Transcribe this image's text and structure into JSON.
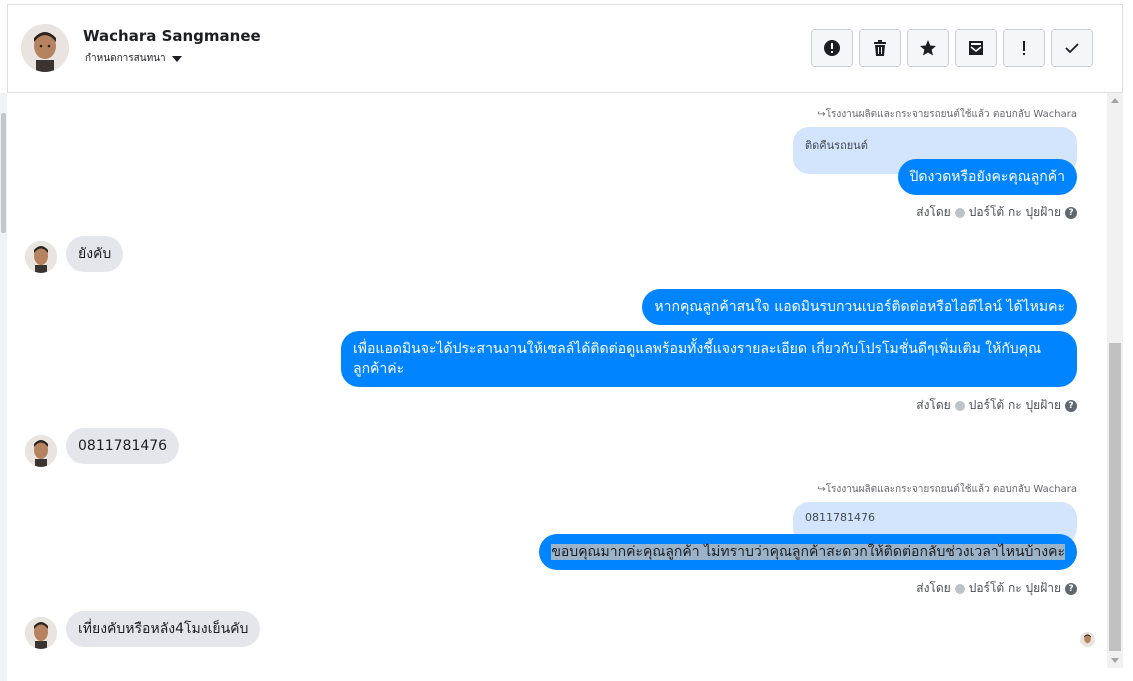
{
  "header": {
    "name": "Wachara Sangmanee",
    "subtitle": "กำหนดการสนทนา",
    "toolbar": [
      {
        "name": "report-icon"
      },
      {
        "name": "trash-icon"
      },
      {
        "name": "star-icon"
      },
      {
        "name": "mark-unread-icon"
      },
      {
        "name": "exclamation-icon"
      },
      {
        "name": "check-icon"
      }
    ]
  },
  "conversation": {
    "reply_note": "โรงงานผลิตและกระจายรถยนต์ใช้แล้ว ตอบกลับ Wachara",
    "sent_by": "ส่งโดย",
    "sender_name": "ปอร์โต้ กะ ปุยฝ้าย",
    "messages": {
      "q1": "ติดคืนรถยนต์",
      "o1": "ปิดงวดหรือยังคะคุณลูกค้า",
      "i1": "ยังคับ",
      "o2": "หากคุณลูกค้าสนใจ แอดมินรบกวนเบอร์ติดต่อหรือไอดีไลน์ ได้ไหมคะ",
      "o3": "เพื่อแอดมินจะได้ประสานงานให้เซลล์ได้ติดต่อดูแลพร้อมทั้งชี้แจงรายละเอียด เกี่ยวกับโปรโมชั่นดีๆเพิ่มเติม ให้กับคุณลูกค้าค่ะ",
      "i2": "0811781476",
      "q2": "0811781476",
      "o4": "ขอบคุณมากค่ะคุณลูกค้า ไม่ทราบว่าคุณลูกค้าสะดวกให้ติดต่อกลับช่วงเวลาไหนบ้างคะ",
      "i3": "เที่ยงคับหรือหลัง4โมงเย็นคับ"
    }
  },
  "colors": {
    "outgoing": "#0084ff",
    "incoming": "#e4e6eb",
    "quoted": "#d3e5fd"
  }
}
